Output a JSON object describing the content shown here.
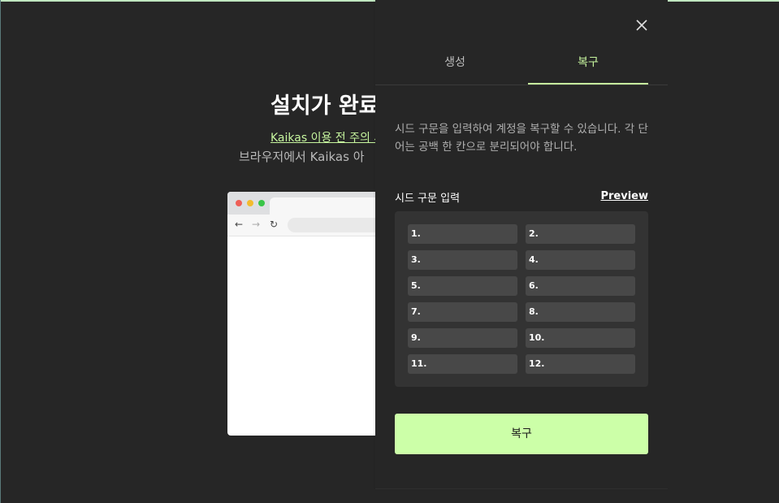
{
  "background": {
    "title": "설치가 완료",
    "link_text": "Kaikas 이용 전 주의 사",
    "description": "브라우저에서 Kaikas 아"
  },
  "panel": {
    "tabs": [
      {
        "label": "생성",
        "active": false
      },
      {
        "label": "복구",
        "active": true
      }
    ],
    "description": "시드 구문을 입력하여 계정을 복구할 수 있습니다. 각 단어는 공백 한 칸으로 분리되어야 합니다.",
    "seed_label": "시드 구문 입력",
    "preview_label": "Preview",
    "seed_fields": [
      "1.",
      "2.",
      "3.",
      "4.",
      "5.",
      "6.",
      "7.",
      "8.",
      "9.",
      "10.",
      "11.",
      "12."
    ],
    "restore_button": "복구"
  },
  "icons": {
    "close": "close-icon",
    "back": "arrow-left-icon",
    "forward": "arrow-right-icon",
    "reload": "reload-icon"
  },
  "colors": {
    "accent": "#c6f59e",
    "button_bg": "#ccffa8",
    "panel_bg": "#262626",
    "seed_box_bg": "#333333",
    "seed_input_bg": "#484848"
  }
}
